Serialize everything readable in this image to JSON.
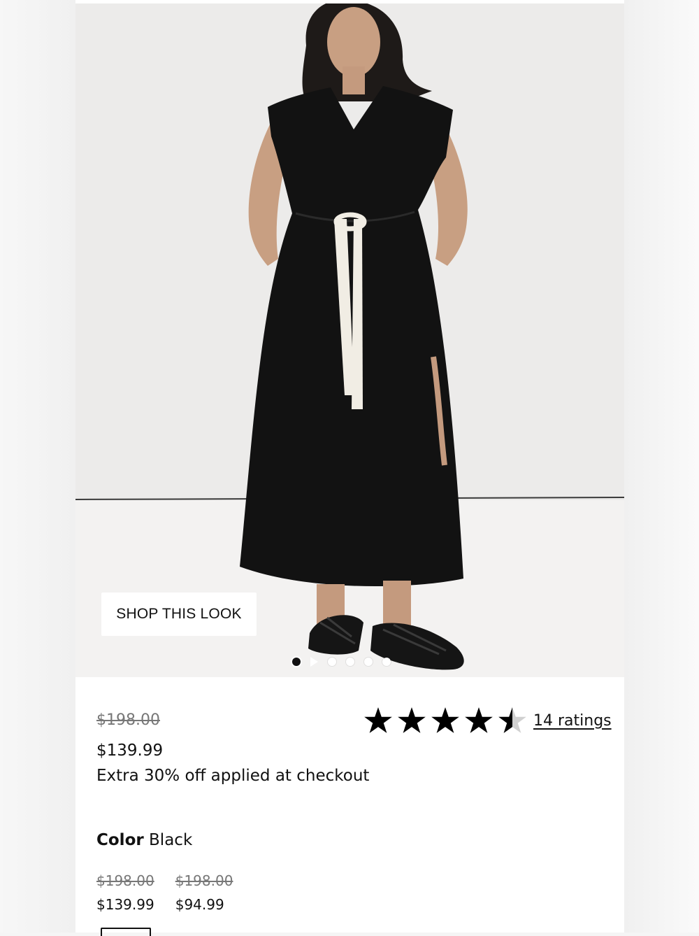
{
  "hero": {
    "shop_look_label": "SHOP THIS LOOK",
    "carousel_slide_count": 6,
    "carousel_active_index": 0,
    "carousel_video_index": 1
  },
  "product": {
    "original_price": "$198.00",
    "sale_price": "$139.99",
    "promo_text": "Extra 30% off applied at checkout",
    "rating_value": 4.5,
    "rating_max": 5,
    "ratings_label": "14 ratings",
    "color_label": "Color",
    "color_value": "Black"
  },
  "variants": [
    {
      "original_price": "$198.00",
      "sale_price": "$139.99"
    },
    {
      "original_price": "$198.00",
      "sale_price": "$94.99"
    }
  ],
  "colors": {
    "background": "#ecebea",
    "dress": "#121212",
    "drawstring": "#f1ede4",
    "text": "#111111",
    "muted": "#777777"
  }
}
